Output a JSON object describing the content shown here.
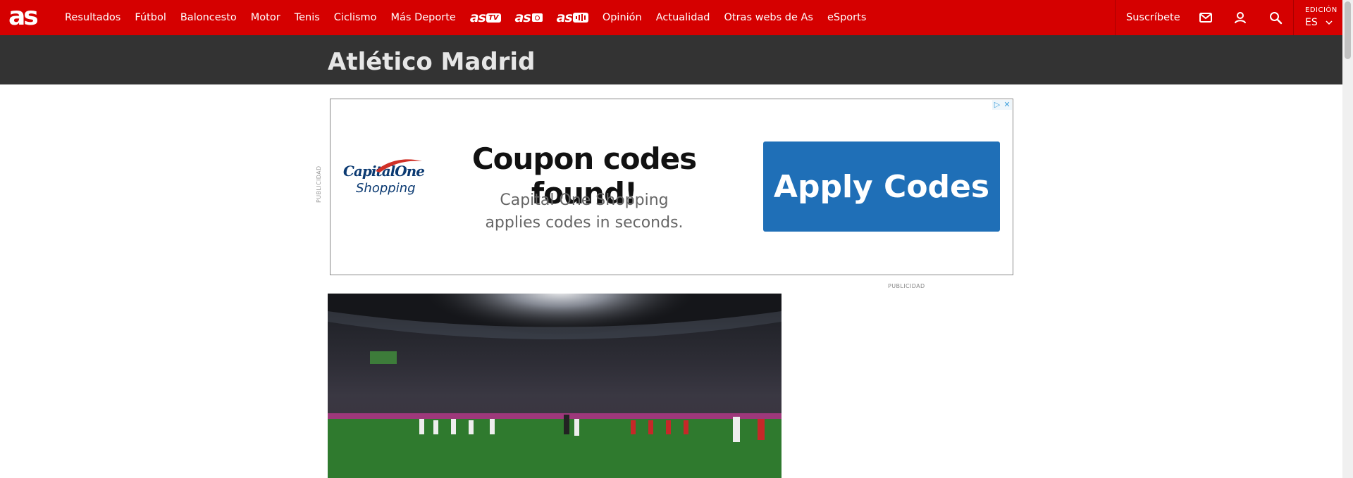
{
  "header": {
    "logo": "as",
    "nav": [
      {
        "type": "text",
        "label": "Resultados"
      },
      {
        "type": "text",
        "label": "Fútbol"
      },
      {
        "type": "text",
        "label": "Baloncesto"
      },
      {
        "type": "text",
        "label": "Motor"
      },
      {
        "type": "text",
        "label": "Tenis"
      },
      {
        "type": "text",
        "label": "Ciclismo"
      },
      {
        "type": "text",
        "label": "Más Deporte"
      },
      {
        "type": "brand",
        "label": "as",
        "badge": "TV"
      },
      {
        "type": "brand",
        "label": "as",
        "icon": "camera-icon"
      },
      {
        "type": "brand",
        "label": "as",
        "badge": "audio"
      },
      {
        "type": "text",
        "label": "Opinión"
      },
      {
        "type": "text",
        "label": "Actualidad"
      },
      {
        "type": "text",
        "label": "Otras webs de As"
      },
      {
        "type": "text",
        "label": "eSports"
      }
    ],
    "subscribe": "Suscríbete",
    "icons": [
      "mail-icon",
      "user-icon",
      "search-icon"
    ],
    "edition_label": "EDICIÓN",
    "edition_value": "ES"
  },
  "section": {
    "title": "Atlético Madrid"
  },
  "ad": {
    "side_label": "PUBLICIDAD",
    "brand_name": "CapitalOne",
    "brand_sub": "Shopping",
    "headline": "Coupon codes found!",
    "sub_line_1": "Capital One Shopping",
    "sub_line_2": "applies codes in seconds.",
    "cta": "Apply Codes"
  },
  "publicidad_label": "PUBLICIDAD",
  "colors": {
    "brand_red": "#d50000",
    "section_band": "#333333",
    "cta_blue": "#1f6fb7",
    "capital_one_navy": "#0b3a72"
  }
}
